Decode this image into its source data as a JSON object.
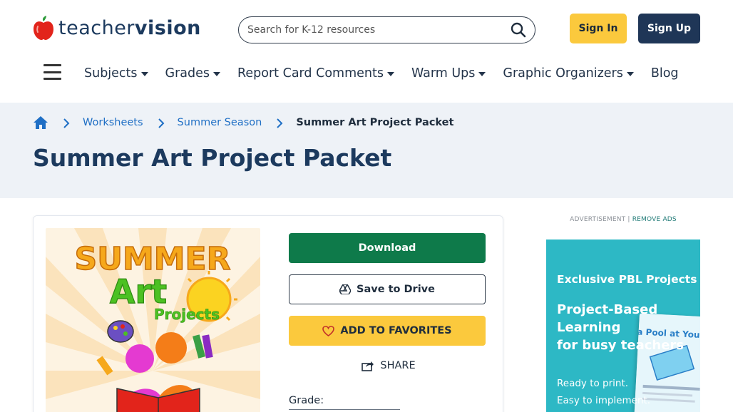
{
  "header": {
    "logo_text_regular": "teacher",
    "logo_text_bold": "vision",
    "search_placeholder": "Search for K-12 resources",
    "signin_label": "Sign In",
    "signup_label": "Sign Up"
  },
  "nav": {
    "items": [
      {
        "label": "Subjects",
        "dropdown": true
      },
      {
        "label": "Grades",
        "dropdown": true
      },
      {
        "label": "Report Card Comments",
        "dropdown": true
      },
      {
        "label": "Warm Ups",
        "dropdown": true
      },
      {
        "label": "Graphic Organizers",
        "dropdown": true
      },
      {
        "label": "Blog",
        "dropdown": false
      }
    ]
  },
  "breadcrumb": {
    "items": [
      "Worksheets",
      "Summer Season"
    ],
    "current": "Summer Art Project Packet"
  },
  "page": {
    "title": "Summer Art Project Packet"
  },
  "thumbnail": {
    "line1": "SUMMER",
    "line2": "Art",
    "line3": "Projects"
  },
  "actions": {
    "download_label": "Download",
    "drive_label": "Save to Drive",
    "favorites_label": "ADD TO FAVORITES",
    "share_label": "SHARE",
    "grade_label": "Grade:"
  },
  "ad": {
    "label": "ADVERTISEMENT |",
    "remove_label": "REMOVE ADS",
    "kicker": "Exclusive PBL Projects",
    "headline_1": "Project-Based",
    "headline_2": "Learning",
    "headline_3": "for busy teachers",
    "sub_1": "Ready to print.",
    "sub_2": "Easy to implement.",
    "book_title": "Build a Pool at Your School"
  },
  "colors": {
    "brand_navy": "#1c3a5e",
    "accent_yellow": "#fbc93d",
    "download_green": "#0e7a4a",
    "link_blue": "#1f6fc5",
    "ad_teal": "#2db8c5"
  }
}
